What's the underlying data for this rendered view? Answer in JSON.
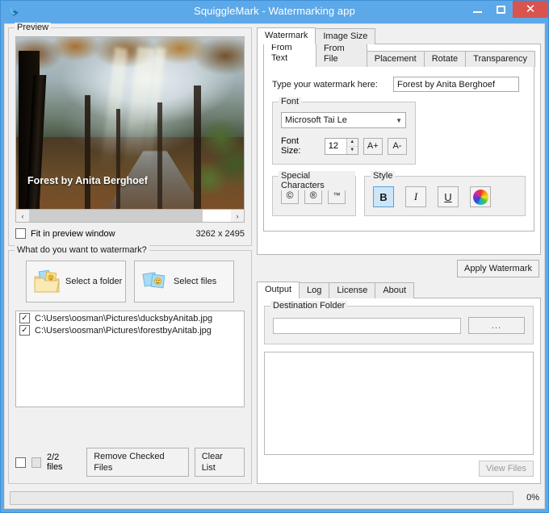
{
  "window": {
    "title": "SquiggleMark - Watermarking app",
    "app_icon": "squiggle-icon",
    "minimize_label": "Minimize",
    "maximize_label": "Maximize",
    "close_label": "Close"
  },
  "preview": {
    "group_label": "Preview",
    "watermark_overlay_text": "Forest by Anita Berghoef",
    "scroll_left_icon": "‹",
    "scroll_right_icon": "›",
    "fit_checkbox_label": "Fit in preview window",
    "fit_checked": false,
    "dimensions": "3262 x 2495"
  },
  "source": {
    "group_label": "What do you want to watermark?",
    "select_folder_label": "Select a folder",
    "select_files_label": "Select files",
    "files": [
      {
        "path": "C:\\Users\\oosman\\Pictures\\ducksbyAnitab.jpg",
        "checked": true
      },
      {
        "path": "C:\\Users\\oosman\\Pictures\\forestbyAnitab.jpg",
        "checked": true
      }
    ],
    "files_count_label": "2/2 files",
    "remove_checked_label": "Remove Checked Files",
    "clear_list_label": "Clear List"
  },
  "main_tabs": [
    {
      "label": "Watermark",
      "active": true
    },
    {
      "label": "Image Size",
      "active": false
    }
  ],
  "watermark_tabs": [
    {
      "label": "From Text",
      "active": true
    },
    {
      "label": "From File",
      "active": false
    },
    {
      "label": "Placement",
      "active": false
    },
    {
      "label": "Rotate",
      "active": false
    },
    {
      "label": "Transparency",
      "active": false
    }
  ],
  "from_text": {
    "prompt_label": "Type your watermark here:",
    "watermark_value": "Forest by Anita Berghoef",
    "font_group_label": "Font",
    "font_value": "Microsoft Tai Le",
    "font_chevron_icon": "⌄",
    "font_size_label": "Font Size:",
    "font_size_value": "12",
    "spin_up_icon": "▲",
    "spin_down_icon": "▼",
    "increase_font_label": "A+",
    "decrease_font_label": "A-",
    "special_group_label": "Special Characters",
    "special_chars": [
      "©",
      "®",
      "™"
    ],
    "style_group_label": "Style",
    "bold_label": "B",
    "bold_selected": true,
    "italic_label": "I",
    "underline_label": "U",
    "color_picker_icon": "color-wheel-icon"
  },
  "apply_button_label": "Apply Watermark",
  "output_tabs": [
    {
      "label": "Output",
      "active": true
    },
    {
      "label": "Log",
      "active": false
    },
    {
      "label": "License",
      "active": false
    },
    {
      "label": "About",
      "active": false
    }
  ],
  "output": {
    "destination_group_label": "Destination Folder",
    "destination_value": "",
    "browse_label": "...",
    "log_value": "",
    "view_files_label": "View Files",
    "view_files_enabled": false
  },
  "status": {
    "progress_percent": 0,
    "progress_label": "0%"
  },
  "colors": {
    "titlebar": "#5da8e8",
    "close_button": "#d9534f",
    "selection": "#cde6f7",
    "panel": "#f0f0f0"
  }
}
